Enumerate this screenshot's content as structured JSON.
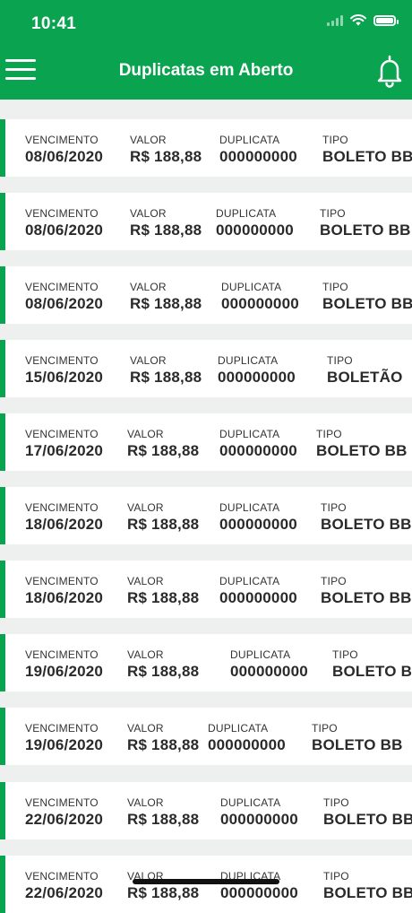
{
  "status": {
    "time": "10:41"
  },
  "header": {
    "title": "Duplicatas em Aberto",
    "menu_icon": "hamburger-menu-icon",
    "bell_icon": "bell-icon",
    "color": "#0aa34f"
  },
  "labels": {
    "vencimento": "VENCIMENTO",
    "valor": "VALOR",
    "duplicata": "DUPLICATA",
    "tipo": "TIPO"
  },
  "items": [
    {
      "vencimento": "08/06/2020",
      "valor": "R$ 188,88",
      "duplicata": "000000000",
      "tipo": "BOLETO BB"
    },
    {
      "vencimento": "08/06/2020",
      "valor": "R$ 188,88",
      "duplicata": "000000000",
      "tipo": "BOLETO BB"
    },
    {
      "vencimento": "08/06/2020",
      "valor": "R$ 188,88",
      "duplicata": "000000000",
      "tipo": "BOLETO BB"
    },
    {
      "vencimento": "15/06/2020",
      "valor": "R$ 188,88",
      "duplicata": "000000000",
      "tipo": "BOLETÃO"
    },
    {
      "vencimento": "17/06/2020",
      "valor": "R$ 188,88",
      "duplicata": "000000000",
      "tipo": "BOLETO BB"
    },
    {
      "vencimento": "18/06/2020",
      "valor": "R$ 188,88",
      "duplicata": "000000000",
      "tipo": "BOLETO BB"
    },
    {
      "vencimento": "18/06/2020",
      "valor": "R$ 188,88",
      "duplicata": "000000000",
      "tipo": "BOLETO BB"
    },
    {
      "vencimento": "19/06/2020",
      "valor": "R$ 188,88",
      "duplicata": "000000000",
      "tipo": "BOLETO B"
    },
    {
      "vencimento": "19/06/2020",
      "valor": "R$ 188,88",
      "duplicata": "000000000",
      "tipo": "BOLETO BB"
    },
    {
      "vencimento": "22/06/2020",
      "valor": "R$ 188,88",
      "duplicata": "000000000",
      "tipo": "BOLETO BB"
    },
    {
      "vencimento": "22/06/2020",
      "valor": "R$ 188,88",
      "duplicata": "000000000",
      "tipo": "BOLETO BB"
    }
  ]
}
